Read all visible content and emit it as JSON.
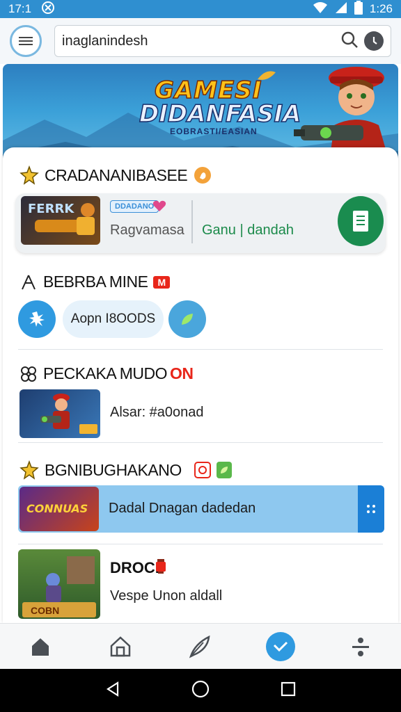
{
  "status_bar": {
    "time_left": "17:1",
    "time_right": "1:26"
  },
  "search": {
    "value": "inaglanindesh"
  },
  "banner": {
    "line1": "GAMESI",
    "line2": "DIDANFASIA",
    "line3": "EOBRASTI/EASIAN"
  },
  "sections": {
    "s1": {
      "title": "CRADANANIBASEE",
      "thumb_text": "FERRK",
      "badge": "DDADANO",
      "subtitle": "Ragvamasa",
      "green_text": "Ganu | dandah"
    },
    "s2": {
      "title": "BEBRBA MINE",
      "title_badge": "M",
      "pill_text": "Aopn I8OODS"
    },
    "s3": {
      "title": "PECKAKA MUDO",
      "title_accent": "ON",
      "row_text": "Alsar: #a0onad"
    },
    "s4": {
      "title": "BGNIBUGHAKANO",
      "thumb_text": "CONNUAS",
      "row_text": "Dadal Dnagan dadedan"
    },
    "s5": {
      "title": "DROCI",
      "row_text": "Vespe Unon aldall",
      "thumb_text": "COBN"
    }
  },
  "colors": {
    "status_bar": "#2f8fd0",
    "accent_red": "#e8261a",
    "green_btn": "#1a8c4f",
    "blue_row": "#8ec8ef",
    "nav_active": "#2f9ae0"
  },
  "bottom_nav": [
    "home-icon",
    "home-outline-icon",
    "feather-icon",
    "check-icon",
    "divide-icon"
  ]
}
